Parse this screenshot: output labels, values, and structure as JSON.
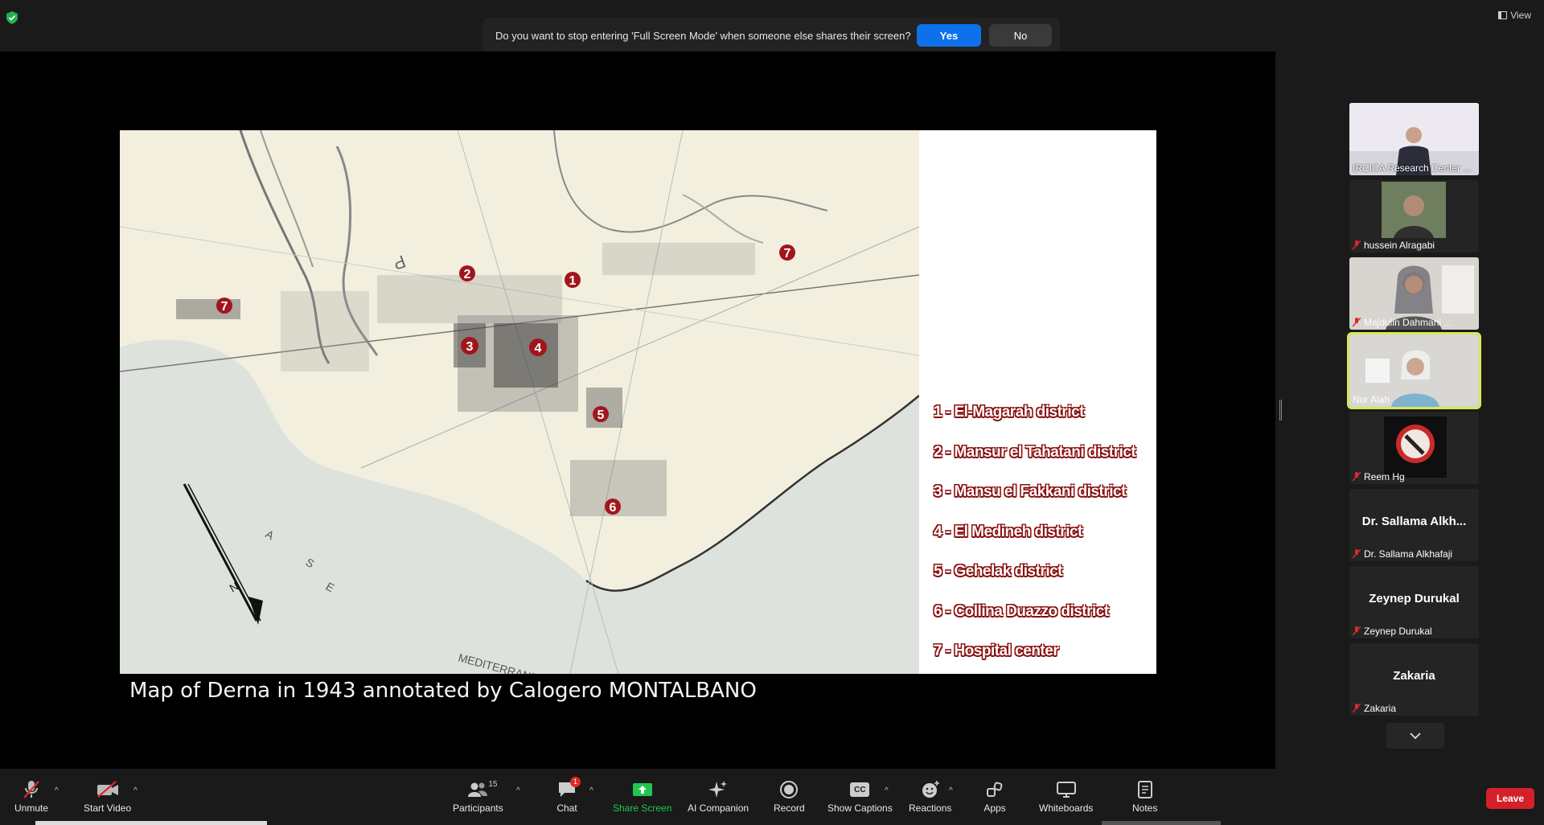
{
  "top": {
    "security_icon": "shield-check-icon",
    "view_label": "View",
    "dialog": {
      "message": "Do you want to stop entering 'Full Screen Mode' when someone else shares their screen?",
      "yes_label": "Yes",
      "no_label": "No"
    }
  },
  "slide": {
    "legend": [
      "1 - El-Magarah district",
      "2 - Mansur el Tahatani district",
      "3 - Mansu el Fakkani district",
      "4 - El Medineh district",
      "5 - Gehelak district",
      "6 - Collina Duazzo district",
      "7 - Hospital center"
    ],
    "map_markers": [
      "1",
      "2",
      "3",
      "4",
      "5",
      "6",
      "7",
      "7"
    ],
    "map_labels": {
      "sea_letters": [
        "S",
        "E",
        "A"
      ],
      "med_letters": [
        "M",
        "E",
        "D",
        "I",
        "T",
        "E",
        "R",
        "R",
        "A",
        "N",
        "E",
        "A",
        "N"
      ],
      "north": "N",
      "p_mark": "P"
    },
    "caption": "Map of Derna in 1943 annotated by Calogero MONTALBANO"
  },
  "participants": [
    {
      "name": "IRCICA Research Center ...",
      "muted": false,
      "type": "video"
    },
    {
      "name": "hussein Alragabi",
      "muted": true,
      "type": "video"
    },
    {
      "name": "Majdulin Dahmani ...",
      "muted": true,
      "type": "video"
    },
    {
      "name": "Nur Alah",
      "muted": false,
      "type": "video",
      "active": true
    },
    {
      "name": "Reem Hg",
      "muted": true,
      "type": "avatar"
    },
    {
      "name": "Dr. Sallama Alkhafaji",
      "big_name": "Dr. Sallama Alkh...",
      "muted": true,
      "type": "name"
    },
    {
      "name": "Zeynep Durukal",
      "big_name": "Zeynep Durukal",
      "muted": true,
      "type": "name"
    },
    {
      "name": "Zakaria",
      "big_name": "Zakaria",
      "muted": true,
      "type": "name"
    }
  ],
  "toolbar": {
    "unmute": "Unmute",
    "start_video": "Start Video",
    "participants": "Participants",
    "participants_count": "15",
    "chat": "Chat",
    "chat_badge": "1",
    "share_screen": "Share Screen",
    "ai_companion": "AI Companion",
    "record": "Record",
    "show_captions": "Show Captions",
    "captions_icon_text": "CC",
    "reactions": "Reactions",
    "apps": "Apps",
    "whiteboards": "Whiteboards",
    "notes": "Notes",
    "leave": "Leave"
  },
  "colors": {
    "accent_blue": "#0e71eb",
    "share_green": "#23c552",
    "leave_red": "#d5202a",
    "active_speaker": "#d7e85a",
    "marker_red": "#a3151d"
  }
}
